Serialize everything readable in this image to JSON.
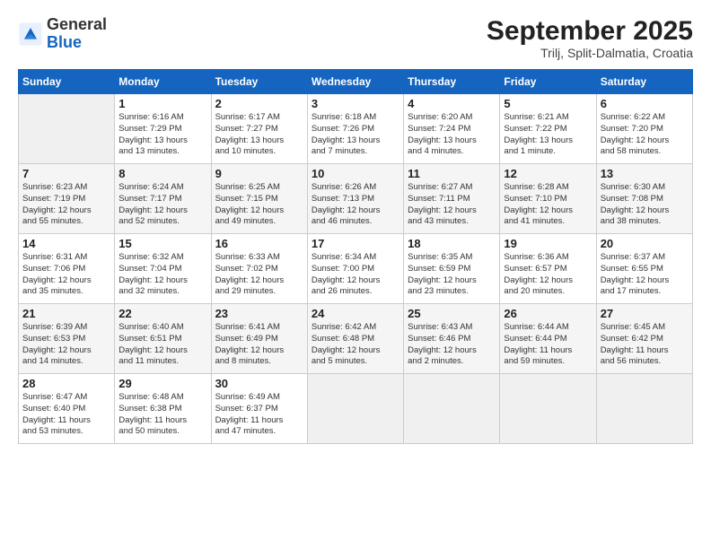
{
  "logo": {
    "line1": "General",
    "line2": "Blue"
  },
  "title": "September 2025",
  "subtitle": "Trilj, Split-Dalmatia, Croatia",
  "weekdays": [
    "Sunday",
    "Monday",
    "Tuesday",
    "Wednesday",
    "Thursday",
    "Friday",
    "Saturday"
  ],
  "weeks": [
    [
      {
        "day": "",
        "content": ""
      },
      {
        "day": "1",
        "content": "Sunrise: 6:16 AM\nSunset: 7:29 PM\nDaylight: 13 hours\nand 13 minutes."
      },
      {
        "day": "2",
        "content": "Sunrise: 6:17 AM\nSunset: 7:27 PM\nDaylight: 13 hours\nand 10 minutes."
      },
      {
        "day": "3",
        "content": "Sunrise: 6:18 AM\nSunset: 7:26 PM\nDaylight: 13 hours\nand 7 minutes."
      },
      {
        "day": "4",
        "content": "Sunrise: 6:20 AM\nSunset: 7:24 PM\nDaylight: 13 hours\nand 4 minutes."
      },
      {
        "day": "5",
        "content": "Sunrise: 6:21 AM\nSunset: 7:22 PM\nDaylight: 13 hours\nand 1 minute."
      },
      {
        "day": "6",
        "content": "Sunrise: 6:22 AM\nSunset: 7:20 PM\nDaylight: 12 hours\nand 58 minutes."
      }
    ],
    [
      {
        "day": "7",
        "content": "Sunrise: 6:23 AM\nSunset: 7:19 PM\nDaylight: 12 hours\nand 55 minutes."
      },
      {
        "day": "8",
        "content": "Sunrise: 6:24 AM\nSunset: 7:17 PM\nDaylight: 12 hours\nand 52 minutes."
      },
      {
        "day": "9",
        "content": "Sunrise: 6:25 AM\nSunset: 7:15 PM\nDaylight: 12 hours\nand 49 minutes."
      },
      {
        "day": "10",
        "content": "Sunrise: 6:26 AM\nSunset: 7:13 PM\nDaylight: 12 hours\nand 46 minutes."
      },
      {
        "day": "11",
        "content": "Sunrise: 6:27 AM\nSunset: 7:11 PM\nDaylight: 12 hours\nand 43 minutes."
      },
      {
        "day": "12",
        "content": "Sunrise: 6:28 AM\nSunset: 7:10 PM\nDaylight: 12 hours\nand 41 minutes."
      },
      {
        "day": "13",
        "content": "Sunrise: 6:30 AM\nSunset: 7:08 PM\nDaylight: 12 hours\nand 38 minutes."
      }
    ],
    [
      {
        "day": "14",
        "content": "Sunrise: 6:31 AM\nSunset: 7:06 PM\nDaylight: 12 hours\nand 35 minutes."
      },
      {
        "day": "15",
        "content": "Sunrise: 6:32 AM\nSunset: 7:04 PM\nDaylight: 12 hours\nand 32 minutes."
      },
      {
        "day": "16",
        "content": "Sunrise: 6:33 AM\nSunset: 7:02 PM\nDaylight: 12 hours\nand 29 minutes."
      },
      {
        "day": "17",
        "content": "Sunrise: 6:34 AM\nSunset: 7:00 PM\nDaylight: 12 hours\nand 26 minutes."
      },
      {
        "day": "18",
        "content": "Sunrise: 6:35 AM\nSunset: 6:59 PM\nDaylight: 12 hours\nand 23 minutes."
      },
      {
        "day": "19",
        "content": "Sunrise: 6:36 AM\nSunset: 6:57 PM\nDaylight: 12 hours\nand 20 minutes."
      },
      {
        "day": "20",
        "content": "Sunrise: 6:37 AM\nSunset: 6:55 PM\nDaylight: 12 hours\nand 17 minutes."
      }
    ],
    [
      {
        "day": "21",
        "content": "Sunrise: 6:39 AM\nSunset: 6:53 PM\nDaylight: 12 hours\nand 14 minutes."
      },
      {
        "day": "22",
        "content": "Sunrise: 6:40 AM\nSunset: 6:51 PM\nDaylight: 12 hours\nand 11 minutes."
      },
      {
        "day": "23",
        "content": "Sunrise: 6:41 AM\nSunset: 6:49 PM\nDaylight: 12 hours\nand 8 minutes."
      },
      {
        "day": "24",
        "content": "Sunrise: 6:42 AM\nSunset: 6:48 PM\nDaylight: 12 hours\nand 5 minutes."
      },
      {
        "day": "25",
        "content": "Sunrise: 6:43 AM\nSunset: 6:46 PM\nDaylight: 12 hours\nand 2 minutes."
      },
      {
        "day": "26",
        "content": "Sunrise: 6:44 AM\nSunset: 6:44 PM\nDaylight: 11 hours\nand 59 minutes."
      },
      {
        "day": "27",
        "content": "Sunrise: 6:45 AM\nSunset: 6:42 PM\nDaylight: 11 hours\nand 56 minutes."
      }
    ],
    [
      {
        "day": "28",
        "content": "Sunrise: 6:47 AM\nSunset: 6:40 PM\nDaylight: 11 hours\nand 53 minutes."
      },
      {
        "day": "29",
        "content": "Sunrise: 6:48 AM\nSunset: 6:38 PM\nDaylight: 11 hours\nand 50 minutes."
      },
      {
        "day": "30",
        "content": "Sunrise: 6:49 AM\nSunset: 6:37 PM\nDaylight: 11 hours\nand 47 minutes."
      },
      {
        "day": "",
        "content": ""
      },
      {
        "day": "",
        "content": ""
      },
      {
        "day": "",
        "content": ""
      },
      {
        "day": "",
        "content": ""
      }
    ]
  ]
}
